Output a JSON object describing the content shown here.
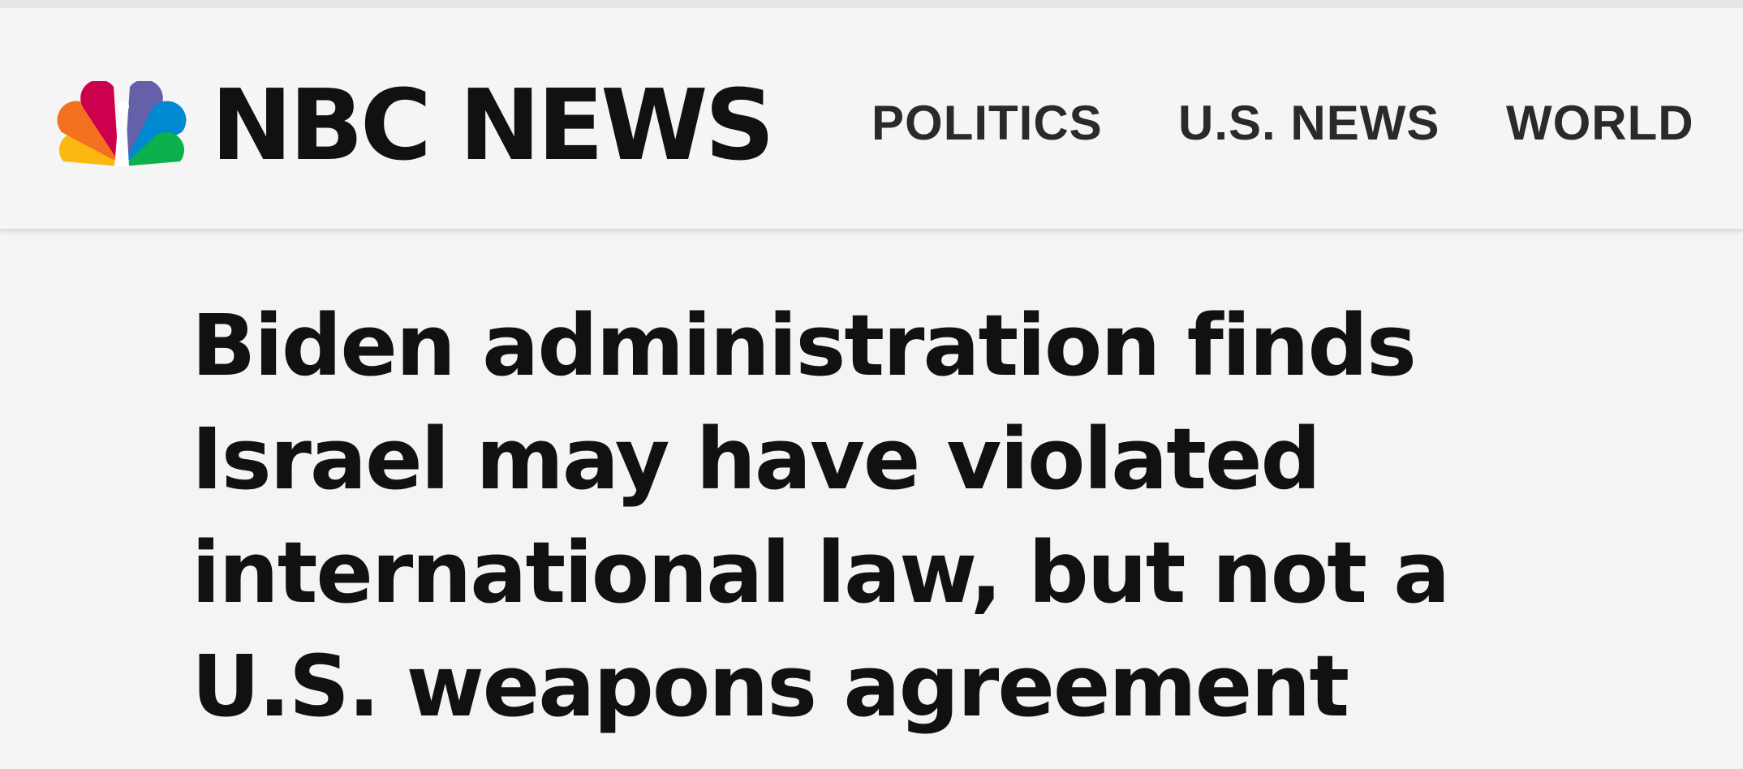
{
  "brand": {
    "name": "NBC NEWS",
    "logo_icon": "peacock-logo-icon",
    "peacock_colors": [
      "#fcb711",
      "#f37021",
      "#cc004c",
      "#6460aa",
      "#0089d0",
      "#0db14b"
    ]
  },
  "nav": {
    "items": [
      {
        "label": "POLITICS"
      },
      {
        "label": "U.S. NEWS"
      },
      {
        "label": "WORLD"
      }
    ]
  },
  "article": {
    "headline": "Biden administration finds Israel may have violated international law, but not a U.S. weapons agreement"
  }
}
